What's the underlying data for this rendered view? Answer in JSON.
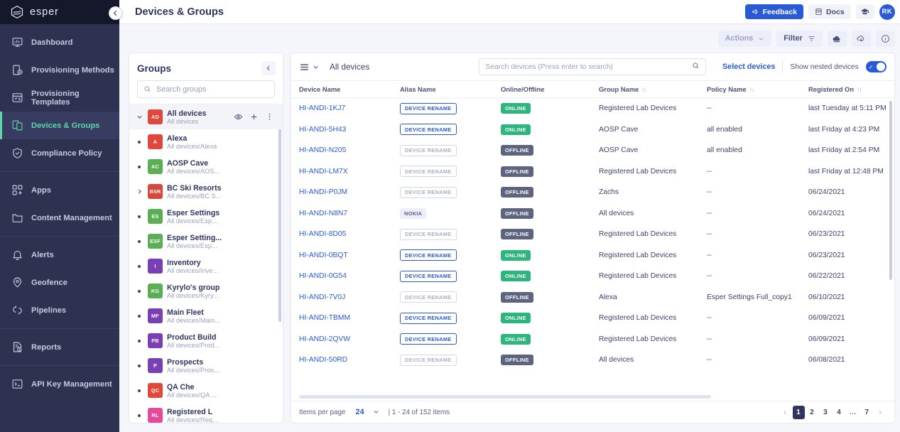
{
  "brand": {
    "name": "esper",
    "logo_icon": "esper-logo-icon",
    "collapse_icon": "chevron-left-icon"
  },
  "sidebar": {
    "groups": [
      {
        "items": [
          {
            "label": "Dashboard",
            "icon": "dashboard-icon",
            "active": false
          },
          {
            "label": "Provisioning Methods",
            "icon": "provisioning-methods-icon",
            "active": false
          },
          {
            "label": "Provisioning Templates",
            "icon": "provisioning-templates-icon",
            "active": false
          },
          {
            "label": "Devices & Groups",
            "icon": "devices-groups-icon",
            "active": true
          },
          {
            "label": "Compliance Policy",
            "icon": "shield-check-icon",
            "active": false
          }
        ]
      },
      {
        "items": [
          {
            "label": "Apps",
            "icon": "apps-icon",
            "active": false
          },
          {
            "label": "Content Management",
            "icon": "folder-icon",
            "active": false
          }
        ]
      },
      {
        "items": [
          {
            "label": "Alerts",
            "icon": "bell-icon",
            "active": false
          },
          {
            "label": "Geofence",
            "icon": "geofence-pin-icon",
            "active": false
          },
          {
            "label": "Pipelines",
            "icon": "pipelines-icon",
            "active": false
          }
        ]
      },
      {
        "items": [
          {
            "label": "Reports",
            "icon": "reports-icon",
            "active": false
          }
        ]
      },
      {
        "items": [
          {
            "label": "API Key Management",
            "icon": "terminal-icon",
            "active": false
          }
        ]
      }
    ],
    "accent_color": "#5ad8a6",
    "background_color": "#2e3150"
  },
  "header": {
    "title": "Devices & Groups",
    "feedback_label": "Feedback",
    "feedback_icon": "megaphone-icon",
    "docs_label": "Docs",
    "docs_icon": "book-icon",
    "graduation_icon": "graduation-cap-icon",
    "avatar_initials": "RK",
    "brand_color": "#2a5bd7"
  },
  "actionbar": {
    "actions_label": "Actions",
    "actions_caret": "chevron-down-icon",
    "filter_label": "Filter",
    "filter_icon": "filter-icon",
    "upload_icon": "cloud-upload-icon",
    "download_icon": "cloud-download-icon",
    "info_icon": "info-circle-icon"
  },
  "groups_panel": {
    "title": "Groups",
    "collapse_icon": "chevron-left-icon",
    "search_placeholder": "Search groups",
    "search_icon": "search-icon",
    "root": {
      "name": "All devices",
      "path": "All devices",
      "initials": "AD",
      "color": "#e0483b",
      "marker": "chevron-down-icon",
      "actions": [
        "eye-icon",
        "plus-icon",
        "more-vertical-icon"
      ]
    },
    "items": [
      {
        "name": "Alexa",
        "path": "All devices/Alexa",
        "initials": "A",
        "color": "#e0483b",
        "marker": "dot"
      },
      {
        "name": "AOSP Cave",
        "path": "All devices/AOS...",
        "initials": "AC",
        "color": "#5cae55",
        "marker": "dot"
      },
      {
        "name": "BC Ski Resorts",
        "path": "All devices/BC S...",
        "initials": "BSR",
        "color": "#d6473c",
        "marker": "chevron-right-icon"
      },
      {
        "name": "Esper Settings",
        "path": "All devices/Esp...",
        "initials": "ES",
        "color": "#5cae55",
        "marker": "dot"
      },
      {
        "name": "Esper Setting...",
        "path": "All devices/Esp...",
        "initials": "ESF",
        "color": "#5cae55",
        "marker": "dot"
      },
      {
        "name": "Inventory",
        "path": "All devices/Inve...",
        "initials": "I",
        "color": "#7a3fb5",
        "marker": "dot"
      },
      {
        "name": "Kyrylo's group",
        "path": "All devices/Kyry...",
        "initials": "KG",
        "color": "#5cae55",
        "marker": "dot"
      },
      {
        "name": "Main Fleet",
        "path": "All devices/Main...",
        "initials": "MF",
        "color": "#7a3fb5",
        "marker": "dot"
      },
      {
        "name": "Product Build",
        "path": "All devices/Prod...",
        "initials": "PB",
        "color": "#7a3fb5",
        "marker": "dot"
      },
      {
        "name": "Prospects",
        "path": "All devices/Pros...",
        "initials": "P",
        "color": "#7a3fb5",
        "marker": "dot"
      },
      {
        "name": "QA Che",
        "path": "All devices/QA ...",
        "initials": "QC",
        "color": "#e0483b",
        "marker": "dot"
      },
      {
        "name": "Registered L",
        "path": "All devices/Reg...",
        "initials": "RL",
        "color": "#e5499b",
        "marker": "dot"
      }
    ]
  },
  "table_toolbar": {
    "view_icon": "list-view-icon",
    "view_caret": "chevron-down-icon",
    "scope_label": "All devices",
    "search_placeholder": "Search devices (Press enter to search)",
    "search_icon": "search-icon",
    "select_devices_label": "Select devices",
    "nested_label": "Show nested devices",
    "nested_enabled": true
  },
  "table": {
    "columns": [
      {
        "label": "Device Name",
        "sortable": false
      },
      {
        "label": "Alias Name",
        "sortable": false
      },
      {
        "label": "Online/Offline",
        "sortable": false
      },
      {
        "label": "Group Name",
        "sortable": true
      },
      {
        "label": "Policy Name",
        "sortable": true
      },
      {
        "label": "Registered On",
        "sortable": true
      }
    ],
    "rows": [
      {
        "device": "HI-ANDI-1KJ7",
        "alias": "DEVICE RENAME",
        "alias_style": "rename",
        "status": "ONLINE",
        "group": "Registered Lab Devices",
        "policy": "--",
        "registered": "last Tuesday at 5:11 PM"
      },
      {
        "device": "HI-ANDI-5H43",
        "alias": "DEVICE RENAME",
        "alias_style": "rename",
        "status": "ONLINE",
        "group": "AOSP Cave",
        "policy": "all enabled",
        "registered": "last Friday at 4:23 PM"
      },
      {
        "device": "HI-ANDI-N205",
        "alias": "DEVICE RENAME",
        "alias_style": "rename-off",
        "status": "OFFLINE",
        "group": "AOSP Cave",
        "policy": "all enabled",
        "registered": "last Friday at 2:54 PM"
      },
      {
        "device": "HI-ANDI-LM7X",
        "alias": "DEVICE RENAME",
        "alias_style": "rename-off",
        "status": "OFFLINE",
        "group": "Registered Lab Devices",
        "policy": "--",
        "registered": "last Friday at 12:48 PM"
      },
      {
        "device": "HI-ANDI-P0JM",
        "alias": "DEVICE RENAME",
        "alias_style": "rename-off",
        "status": "OFFLINE",
        "group": "Zachs",
        "policy": "--",
        "registered": "06/24/2021"
      },
      {
        "device": "HI-ANDI-N8N7",
        "alias": "NOKIA",
        "alias_style": "brand",
        "status": "OFFLINE",
        "group": "All devices",
        "policy": "--",
        "registered": "06/24/2021"
      },
      {
        "device": "HI-ANDI-8D05",
        "alias": "DEVICE RENAME",
        "alias_style": "rename-off",
        "status": "OFFLINE",
        "group": "Registered Lab Devices",
        "policy": "--",
        "registered": "06/23/2021"
      },
      {
        "device": "HI-ANDI-0BQT",
        "alias": "DEVICE RENAME",
        "alias_style": "rename",
        "status": "ONLINE",
        "group": "Registered Lab Devices",
        "policy": "--",
        "registered": "06/23/2021"
      },
      {
        "device": "HI-ANDI-0G54",
        "alias": "DEVICE RENAME",
        "alias_style": "rename",
        "status": "ONLINE",
        "group": "Registered Lab Devices",
        "policy": "--",
        "registered": "06/22/2021"
      },
      {
        "device": "HI-ANDI-7V0J",
        "alias": "DEVICE RENAME",
        "alias_style": "rename-off",
        "status": "OFFLINE",
        "group": "Alexa",
        "policy": "Esper Settings Full_copy1",
        "registered": "06/10/2021"
      },
      {
        "device": "HI-ANDI-TBMM",
        "alias": "DEVICE RENAME",
        "alias_style": "rename",
        "status": "ONLINE",
        "group": "Registered Lab Devices",
        "policy": "--",
        "registered": "06/09/2021"
      },
      {
        "device": "HI-ANDI-2QVW",
        "alias": "DEVICE RENAME",
        "alias_style": "rename",
        "status": "ONLINE",
        "group": "Registered Lab Devices",
        "policy": "--",
        "registered": "06/09/2021"
      },
      {
        "device": "HI-ANDI-50RD",
        "alias": "DEVICE RENAME",
        "alias_style": "rename-off",
        "status": "OFFLINE",
        "group": "All devices",
        "policy": "--",
        "registered": "06/08/2021"
      }
    ]
  },
  "footer": {
    "items_per_page_label": "Items per page",
    "items_per_page_value": "24",
    "caret_icon": "chevron-down-icon",
    "range_label": "| 1 - 24 of 152 items",
    "prev_icon": "chevron-left-icon",
    "next_icon": "chevron-right-icon",
    "pages": [
      "1",
      "2",
      "3",
      "4",
      "…",
      "7"
    ],
    "active_page": "1"
  },
  "colors": {
    "accent_blue": "#2a5bd7",
    "online_green": "#2cb67d",
    "offline_gray": "#5c6480",
    "sidebar_navy": "#2e3150",
    "sidebar_active_green": "#5ad8a6"
  }
}
